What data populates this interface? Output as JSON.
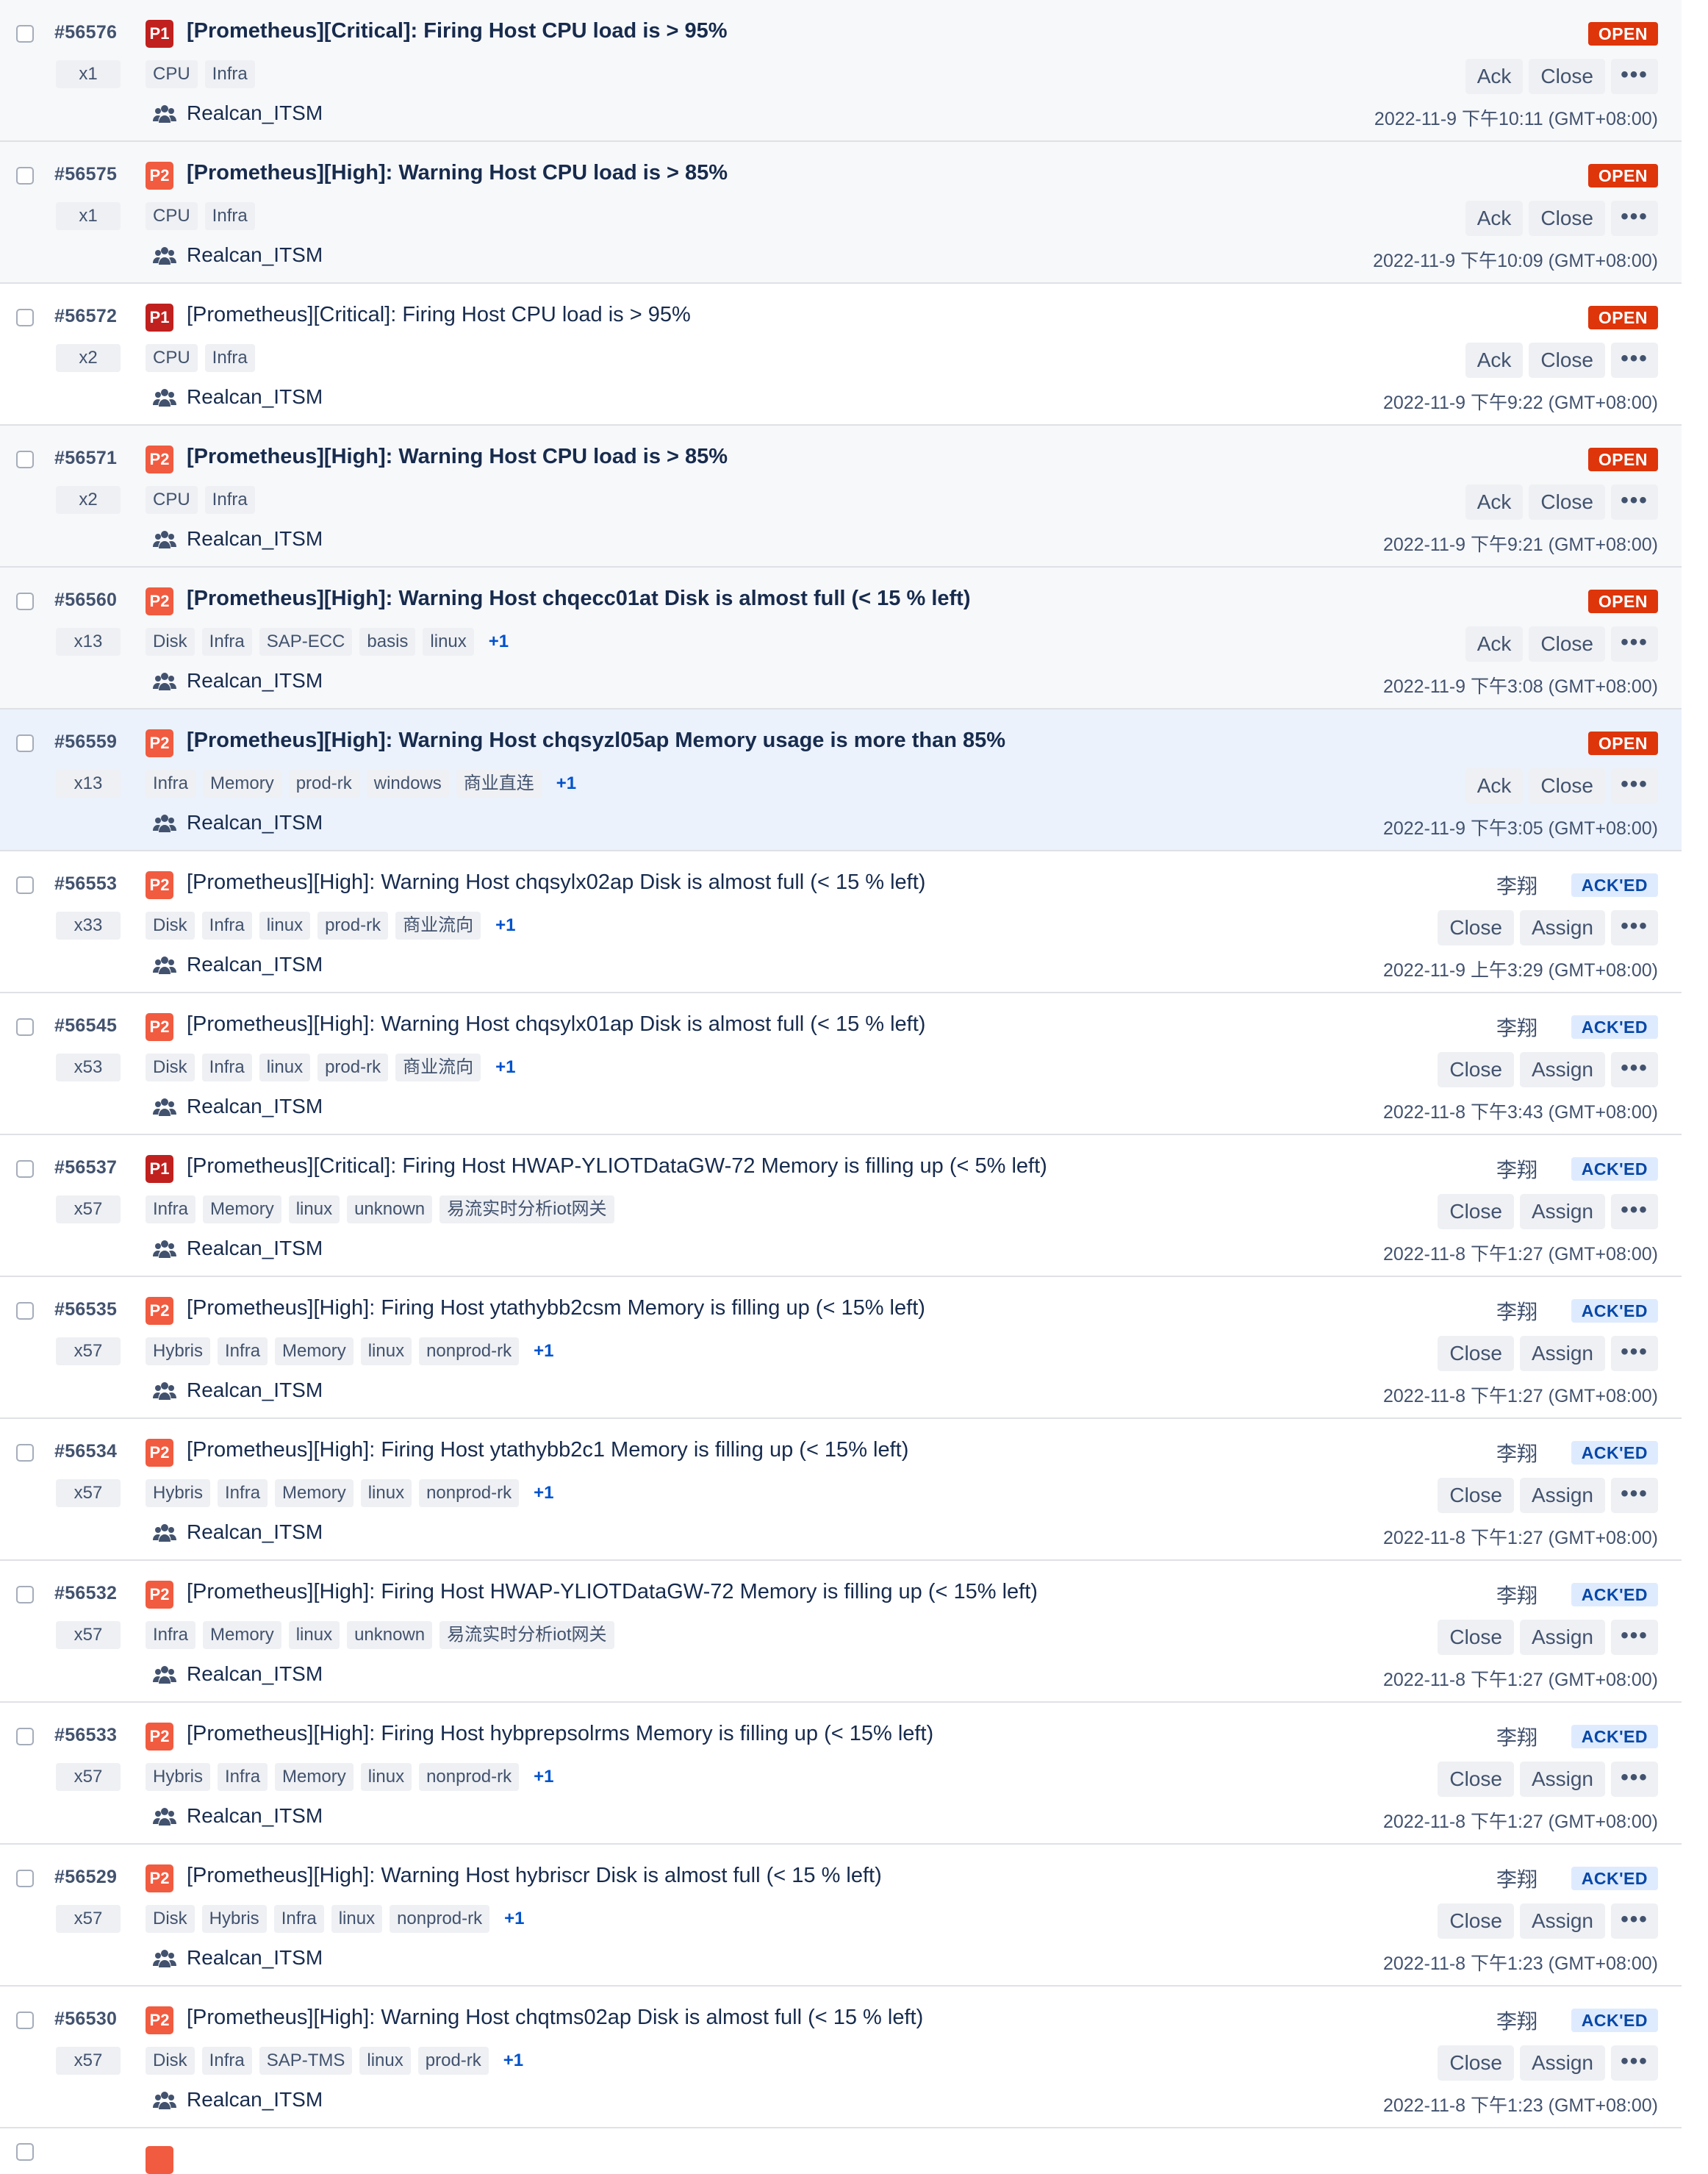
{
  "team_label": "Realcan_ITSM",
  "colors": {
    "p1": "#c0201e",
    "p2": "#f15b40",
    "open": "#de350b",
    "acked_bg": "#deebff",
    "acked_text": "#0747a6"
  },
  "icons": {
    "checkbox": "checkbox-icon",
    "team": "team-icon",
    "more": "more-horizontal-icon"
  },
  "incidents": [
    {
      "id": "#56576",
      "count": "x1",
      "priority": "P1",
      "title": "[Prometheus][Critical]: Firing Host CPU load is > 95%",
      "bold": true,
      "tags": [
        "CPU",
        "Infra"
      ],
      "more": "",
      "status": "OPEN",
      "assignee": "",
      "actions": [
        "Ack",
        "Close"
      ],
      "time": "2022-11-9 下午10:11 (GMT+08:00)",
      "style": "unread"
    },
    {
      "id": "#56575",
      "count": "x1",
      "priority": "P2",
      "title": "[Prometheus][High]: Warning Host CPU load is > 85%",
      "bold": true,
      "tags": [
        "CPU",
        "Infra"
      ],
      "more": "",
      "status": "OPEN",
      "assignee": "",
      "actions": [
        "Ack",
        "Close"
      ],
      "time": "2022-11-9 下午10:09 (GMT+08:00)",
      "style": "unread"
    },
    {
      "id": "#56572",
      "count": "x2",
      "priority": "P1",
      "title": "[Prometheus][Critical]: Firing Host CPU load is > 95%",
      "bold": false,
      "tags": [
        "CPU",
        "Infra"
      ],
      "more": "",
      "status": "OPEN",
      "assignee": "",
      "actions": [
        "Ack",
        "Close"
      ],
      "time": "2022-11-9 下午9:22 (GMT+08:00)",
      "style": ""
    },
    {
      "id": "#56571",
      "count": "x2",
      "priority": "P2",
      "title": "[Prometheus][High]: Warning Host CPU load is > 85%",
      "bold": true,
      "tags": [
        "CPU",
        "Infra"
      ],
      "more": "",
      "status": "OPEN",
      "assignee": "",
      "actions": [
        "Ack",
        "Close"
      ],
      "time": "2022-11-9 下午9:21 (GMT+08:00)",
      "style": "unread"
    },
    {
      "id": "#56560",
      "count": "x13",
      "priority": "P2",
      "title": "[Prometheus][High]: Warning Host chqecc01at Disk is almost full (< 15 % left)",
      "bold": true,
      "tags": [
        "Disk",
        "Infra",
        "SAP-ECC",
        "basis",
        "linux"
      ],
      "more": "+1",
      "status": "OPEN",
      "assignee": "",
      "actions": [
        "Ack",
        "Close"
      ],
      "time": "2022-11-9 下午3:08 (GMT+08:00)",
      "style": "unread"
    },
    {
      "id": "#56559",
      "count": "x13",
      "priority": "P2",
      "title": "[Prometheus][High]: Warning Host chqsyzl05ap Memory usage is more than 85%",
      "bold": true,
      "tags": [
        "Infra",
        "Memory",
        "prod-rk",
        "windows",
        "商业直连"
      ],
      "more": "+1",
      "status": "OPEN",
      "assignee": "",
      "actions": [
        "Ack",
        "Close"
      ],
      "time": "2022-11-9 下午3:05 (GMT+08:00)",
      "style": "highlight"
    },
    {
      "id": "#56553",
      "count": "x33",
      "priority": "P2",
      "title": "[Prometheus][High]: Warning Host chqsylx02ap Disk is almost full (< 15 % left)",
      "bold": false,
      "tags": [
        "Disk",
        "Infra",
        "linux",
        "prod-rk",
        "商业流向"
      ],
      "more": "+1",
      "status": "ACK'ED",
      "assignee": "李翔",
      "actions": [
        "Close",
        "Assign"
      ],
      "time": "2022-11-9 上午3:29 (GMT+08:00)",
      "style": ""
    },
    {
      "id": "#56545",
      "count": "x53",
      "priority": "P2",
      "title": "[Prometheus][High]: Warning Host chqsylx01ap Disk is almost full (< 15 % left)",
      "bold": false,
      "tags": [
        "Disk",
        "Infra",
        "linux",
        "prod-rk",
        "商业流向"
      ],
      "more": "+1",
      "status": "ACK'ED",
      "assignee": "李翔",
      "actions": [
        "Close",
        "Assign"
      ],
      "time": "2022-11-8 下午3:43 (GMT+08:00)",
      "style": ""
    },
    {
      "id": "#56537",
      "count": "x57",
      "priority": "P1",
      "title": "[Prometheus][Critical]: Firing Host HWAP-YLIOTDataGW-72 Memory is filling up (< 5% left)",
      "bold": false,
      "tags": [
        "Infra",
        "Memory",
        "linux",
        "unknown",
        "易流实时分析iot网关"
      ],
      "more": "",
      "status": "ACK'ED",
      "assignee": "李翔",
      "actions": [
        "Close",
        "Assign"
      ],
      "time": "2022-11-8 下午1:27 (GMT+08:00)",
      "style": ""
    },
    {
      "id": "#56535",
      "count": "x57",
      "priority": "P2",
      "title": "[Prometheus][High]: Firing Host ytathybb2csm Memory is filling up (< 15% left)",
      "bold": false,
      "tags": [
        "Hybris",
        "Infra",
        "Memory",
        "linux",
        "nonprod-rk"
      ],
      "more": "+1",
      "status": "ACK'ED",
      "assignee": "李翔",
      "actions": [
        "Close",
        "Assign"
      ],
      "time": "2022-11-8 下午1:27 (GMT+08:00)",
      "style": ""
    },
    {
      "id": "#56534",
      "count": "x57",
      "priority": "P2",
      "title": "[Prometheus][High]: Firing Host ytathybb2c1 Memory is filling up (< 15% left)",
      "bold": false,
      "tags": [
        "Hybris",
        "Infra",
        "Memory",
        "linux",
        "nonprod-rk"
      ],
      "more": "+1",
      "status": "ACK'ED",
      "assignee": "李翔",
      "actions": [
        "Close",
        "Assign"
      ],
      "time": "2022-11-8 下午1:27 (GMT+08:00)",
      "style": ""
    },
    {
      "id": "#56532",
      "count": "x57",
      "priority": "P2",
      "title": "[Prometheus][High]: Firing Host HWAP-YLIOTDataGW-72 Memory is filling up (< 15% left)",
      "bold": false,
      "tags": [
        "Infra",
        "Memory",
        "linux",
        "unknown",
        "易流实时分析iot网关"
      ],
      "more": "",
      "status": "ACK'ED",
      "assignee": "李翔",
      "actions": [
        "Close",
        "Assign"
      ],
      "time": "2022-11-8 下午1:27 (GMT+08:00)",
      "style": ""
    },
    {
      "id": "#56533",
      "count": "x57",
      "priority": "P2",
      "title": "[Prometheus][High]: Firing Host hybprepsolrms Memory is filling up (< 15% left)",
      "bold": false,
      "tags": [
        "Hybris",
        "Infra",
        "Memory",
        "linux",
        "nonprod-rk"
      ],
      "more": "+1",
      "status": "ACK'ED",
      "assignee": "李翔",
      "actions": [
        "Close",
        "Assign"
      ],
      "time": "2022-11-8 下午1:27 (GMT+08:00)",
      "style": ""
    },
    {
      "id": "#56529",
      "count": "x57",
      "priority": "P2",
      "title": "[Prometheus][High]: Warning Host hybriscr Disk is almost full (< 15 % left)",
      "bold": false,
      "tags": [
        "Disk",
        "Hybris",
        "Infra",
        "linux",
        "nonprod-rk"
      ],
      "more": "+1",
      "status": "ACK'ED",
      "assignee": "李翔",
      "actions": [
        "Close",
        "Assign"
      ],
      "time": "2022-11-8 下午1:23 (GMT+08:00)",
      "style": ""
    },
    {
      "id": "#56530",
      "count": "x57",
      "priority": "P2",
      "title": "[Prometheus][High]: Warning Host chqtms02ap Disk is almost full (< 15 % left)",
      "bold": false,
      "tags": [
        "Disk",
        "Infra",
        "SAP-TMS",
        "linux",
        "prod-rk"
      ],
      "more": "+1",
      "status": "ACK'ED",
      "assignee": "李翔",
      "actions": [
        "Close",
        "Assign"
      ],
      "time": "2022-11-8 下午1:23 (GMT+08:00)",
      "style": ""
    }
  ]
}
